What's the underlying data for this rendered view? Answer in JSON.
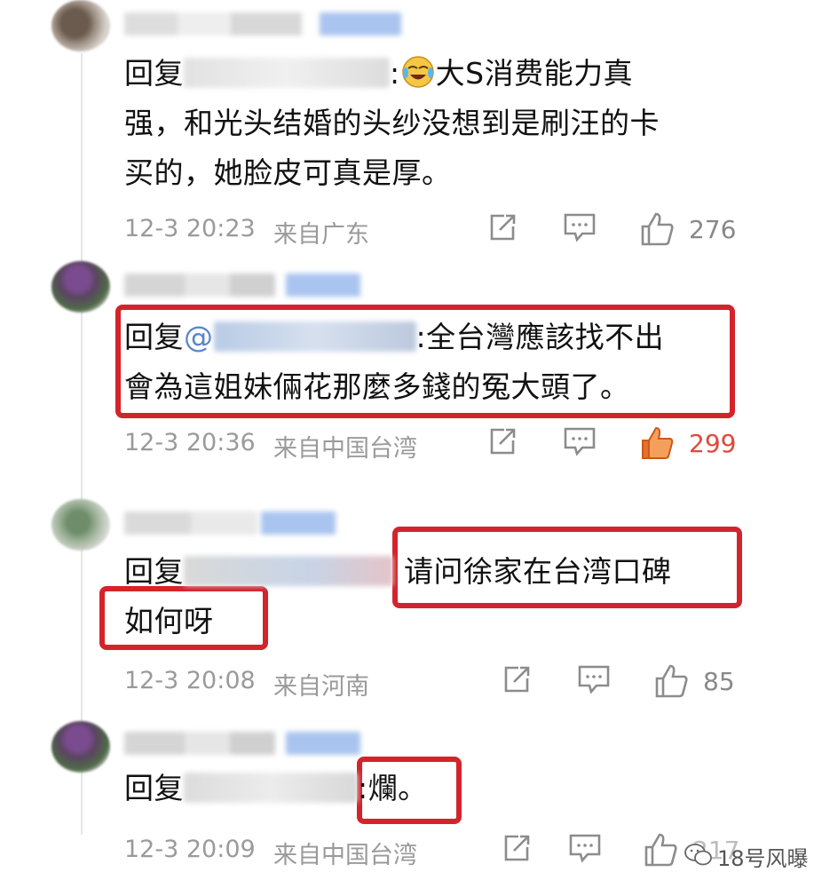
{
  "comments": [
    {
      "reply_prefix": "回复",
      "text_line1": "大S消费能力真",
      "text_line2": "强，和光头结婚的头纱没想到是刷汪的卡",
      "text_line3": "买的，她脸皮可真是厚。",
      "time": "12-3 20:23",
      "source": "来自广东",
      "likes": "276",
      "liked": false
    },
    {
      "reply_prefix": "回复",
      "mention_partial": "@",
      "text_line1": ":全台灣應該找不出",
      "text_line2": "會為這姐妹倆花那麼多錢的冤大頭了。",
      "time": "12-3 20:36",
      "source": "来自中国台湾",
      "likes": "299",
      "liked": true
    },
    {
      "reply_prefix": "回复",
      "text_line1": "请问徐家在台湾口碑",
      "text_line2": "如何呀",
      "time": "12-3 20:08",
      "source": "来自河南",
      "likes": "85",
      "liked": false
    },
    {
      "reply_prefix": "回复",
      "text_line1": ":爛。",
      "time": "12-3 20:09",
      "source": "来自中国台湾",
      "likes": "217",
      "liked": false
    }
  ],
  "watermark": "18号风曝",
  "colors": {
    "highlight_border": "#d3242c",
    "meta_gray": "#9a9a9a",
    "liked_orange": "#e86f2c",
    "liked_count_red": "#e0483a",
    "mention_blue": "#5a86c9"
  },
  "icons": [
    "share-icon",
    "comment-icon",
    "like-icon"
  ]
}
